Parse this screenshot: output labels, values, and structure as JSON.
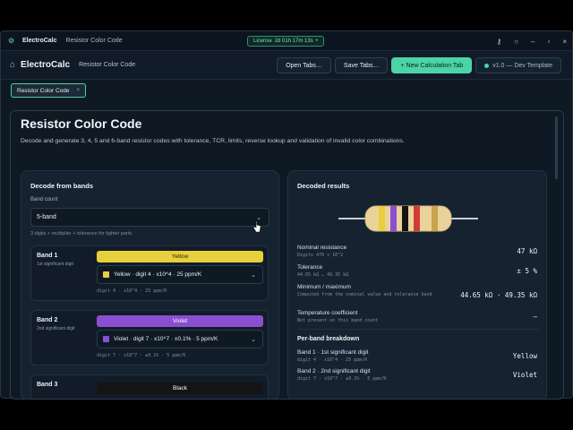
{
  "titlebar": {
    "app": "ElectroCalc",
    "page": "Resistor Color Code",
    "license_label": "License",
    "license_value": "2d 01h 17m 13s",
    "license_dot": "•"
  },
  "header": {
    "app": "ElectroCalc",
    "page": "Resistor Color Code",
    "open_tabs": "Open Tabs…",
    "save_tabs": "Save Tabs…",
    "new_tab": "+ New Calculation Tab",
    "version": "v1.0 — Dev Template"
  },
  "tabs": [
    {
      "label": "Resistor Color Code",
      "close": "×"
    }
  ],
  "page": {
    "title": "Resistor Color Code",
    "description": "Decode and generate 3, 4, 5 and 6-band resistor codes with tolerance, TCR, limits, reverse lookup and validation of invalid color combinations."
  },
  "decode": {
    "title": "Decode from bands",
    "band_count_label": "Band count",
    "band_count_value": "5-band",
    "hint": "3 digits + multiplier + tolerance for tighter parts.",
    "bands": [
      {
        "name": "Band 1",
        "sub": "1st significant digit",
        "color_label": "Yellow",
        "color": "#e8cf3c",
        "text_color": "#2a2204",
        "select": "Yellow · digit 4 · x10^4 · 25 ppm/K",
        "meta": "digit 4 · x10^4 · 25 ppm/K"
      },
      {
        "name": "Band 2",
        "sub": "2nd significant digit",
        "color_label": "Violet",
        "color": "#8a4fd1",
        "text_color": "#ffffff",
        "select": "Violet · digit 7 · x10^7 · ±0.1% · 5 ppm/K",
        "meta": "digit 7 · x10^7 · ±0.1% · 5 ppm/K"
      },
      {
        "name": "Band 3",
        "sub": "",
        "color_label": "Black",
        "color": "#141414",
        "text_color": "#ffffff",
        "select": "",
        "meta": ""
      }
    ]
  },
  "results": {
    "title": "Decoded results",
    "rows": [
      {
        "k": "Nominal resistance",
        "s": "Digits 470 × 10^2",
        "v": "47 kΩ"
      },
      {
        "k": "Tolerance",
        "s": "44.65 kΩ … 49.35 kΩ",
        "v": "± 5 %"
      },
      {
        "k": "Minimum / maximum",
        "s": "Computed from the nominal value and tolerance band",
        "v": "44.65 kΩ · 49.35 kΩ"
      },
      {
        "k": "Temperature coefficient",
        "s": "Not present on this band count",
        "v": "—"
      }
    ],
    "breakdown_title": "Per-band breakdown",
    "breakdown": [
      {
        "k": "Band 1 · 1st significant digit",
        "s": "digit 4 · x10^4 · 25 ppm/K",
        "v": "Yellow"
      },
      {
        "k": "Band 2 · 2nd significant digit",
        "s": "digit 7 · x10^7 · ±0.1% · 5 ppm/K",
        "v": "Violet"
      }
    ]
  },
  "colors": {
    "accent": "#4cd3a8",
    "background": "#0f1924",
    "panel": "#16222f",
    "resistor_body": "#e9d39a",
    "resistor_bands": [
      "#e8cf3c",
      "#8a4fd1",
      "#141414",
      "#d23a3a",
      "#c9a54a"
    ]
  }
}
